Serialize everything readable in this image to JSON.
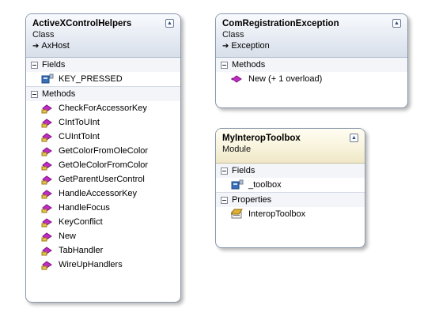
{
  "shapes": {
    "activex": {
      "title": "ActiveXControlHelpers",
      "stereotype": "Class",
      "base": "AxHost",
      "fields_label": "Fields",
      "fields": [
        "KEY_PRESSED"
      ],
      "methods_label": "Methods",
      "methods": [
        "CheckForAccessorKey",
        "CIntToUInt",
        "CUIntToInt",
        "GetColorFromOleColor",
        "GetOleColorFromColor",
        "GetParentUserControl",
        "HandleAccessorKey",
        "HandleFocus",
        "KeyConflict",
        "New",
        "TabHandler",
        "WireUpHandlers"
      ]
    },
    "comreg": {
      "title": "ComRegistrationException",
      "stereotype": "Class",
      "base": "Exception",
      "methods_label": "Methods",
      "methods": [
        "New (+ 1 overload)"
      ]
    },
    "interop": {
      "title": "MyInteropToolbox",
      "stereotype": "Module",
      "fields_label": "Fields",
      "fields": [
        "_toolbox"
      ],
      "properties_label": "Properties",
      "properties": [
        "InteropToolbox"
      ]
    }
  },
  "icons": {
    "collapse": "chevron-up-icon",
    "field": "field-icon",
    "method": "method-icon",
    "property": "property-icon",
    "inherit": "inheritance-arrow-icon"
  },
  "colors": {
    "class_header": "#e6ebf3",
    "module_header": "#fbf7e2",
    "border": "#8a98ad",
    "method_icon": "#c02bc4",
    "field_icon": "#3a6fb7",
    "property_icon": "#e0b030"
  }
}
